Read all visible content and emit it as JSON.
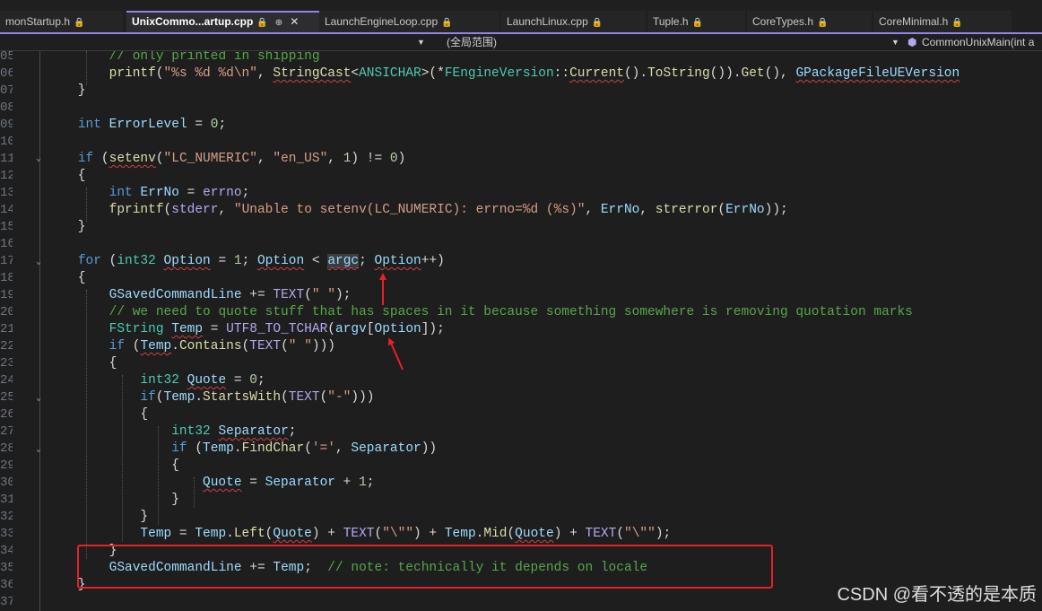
{
  "tabs": [
    {
      "label": "monStartup.h",
      "active": false
    },
    {
      "label": "UnixCommo...artup.cpp",
      "active": true
    },
    {
      "label": "LaunchEngineLoop.cpp",
      "active": false
    },
    {
      "label": "LaunchLinux.cpp",
      "active": false
    },
    {
      "label": "Tuple.h",
      "active": false
    },
    {
      "label": "CoreTypes.h",
      "active": false
    },
    {
      "label": "CoreMinimal.h",
      "active": false
    }
  ],
  "navbar": {
    "scope": "(全局范围)",
    "function": "CommonUnixMain(int a"
  },
  "code": {
    "line_numbers": [
      "05",
      "06",
      "07",
      "08",
      "09",
      "10",
      "11",
      "12",
      "13",
      "14",
      "15",
      "16",
      "17",
      "18",
      "19",
      "20",
      "21",
      "22",
      "23",
      "24",
      "25",
      "26",
      "27",
      "28",
      "29",
      "30",
      "31",
      "32",
      "33",
      "34",
      "35",
      "36",
      "37"
    ]
  },
  "annotations": {
    "highlight_box_color": "#e8202a",
    "arrow_color": "#e8202a"
  },
  "watermark": "CSDN @看不透的是本质"
}
